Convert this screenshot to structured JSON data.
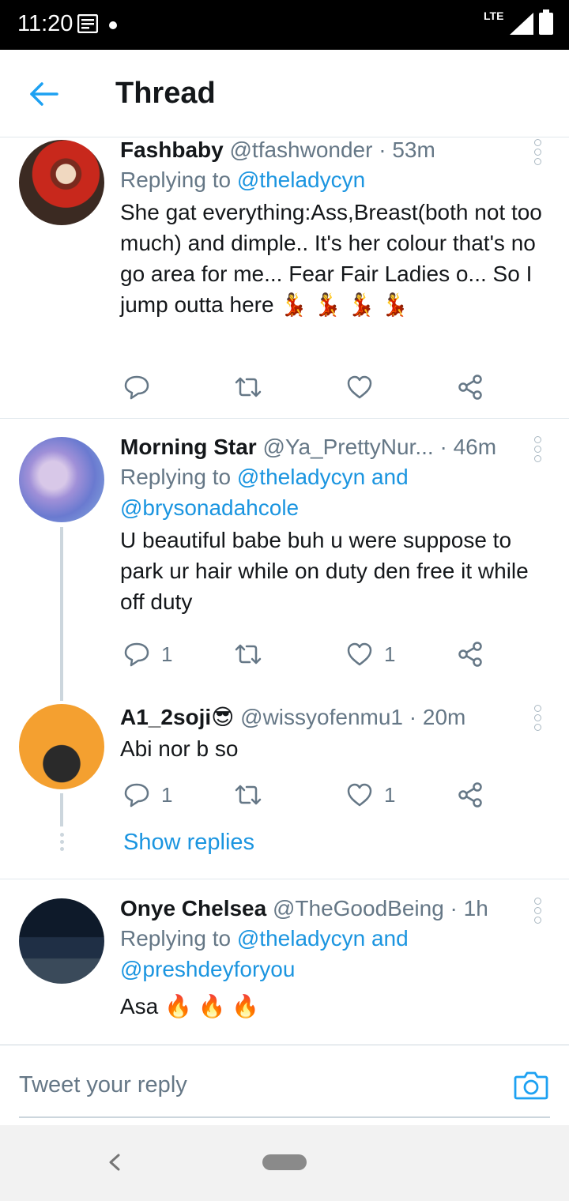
{
  "status_bar": {
    "time": "11:20",
    "network": "LTE"
  },
  "header": {
    "title": "Thread"
  },
  "tweets": [
    {
      "name": "Fashbaby",
      "handle": "@tfashwonder",
      "time": "53m",
      "replying_prefix": "Replying to ",
      "replying_to": "@theladycyn",
      "replying_to_2": "",
      "text": "She gat everything:Ass,Breast(both not too much) and dimple.. It's her colour that's no go area for me... Fear Fair Ladies o... So I jump outta here 💃 💃 💃 💃",
      "reply_count": "",
      "like_count": ""
    },
    {
      "name": "Morning Star",
      "handle": "@Ya_PrettyNur...",
      "time": "46m",
      "replying_prefix": "Replying to ",
      "replying_to": "@theladycyn and",
      "replying_to_2": "@brysonadahcole",
      "text": "U beautiful babe buh u were suppose to park ur hair while on duty den free it while off duty",
      "reply_count": "1",
      "like_count": "1"
    },
    {
      "name": "A1_2soji😎",
      "handle": "@wissyofenmu1",
      "time": "20m",
      "text": "Abi nor b so",
      "reply_count": "1",
      "like_count": "1"
    },
    {
      "name": "Onye Chelsea",
      "handle": "@TheGoodBeing",
      "time": "1h",
      "replying_prefix": "Replying to ",
      "replying_to": "@theladycyn and",
      "replying_to_2": "@preshdeyforyou",
      "text": "Asa 🔥 🔥 🔥"
    }
  ],
  "show_replies": "Show replies",
  "composer": {
    "placeholder": "Tweet your reply"
  },
  "colors": {
    "accent": "#1b95e0",
    "secondary_text": "#657786",
    "divider": "#e1e8ed",
    "status_bar": "#000000"
  },
  "icons": [
    "back-arrow-icon",
    "reply-icon",
    "retweet-icon",
    "like-icon",
    "share-icon",
    "more-icon",
    "camera-icon"
  ]
}
